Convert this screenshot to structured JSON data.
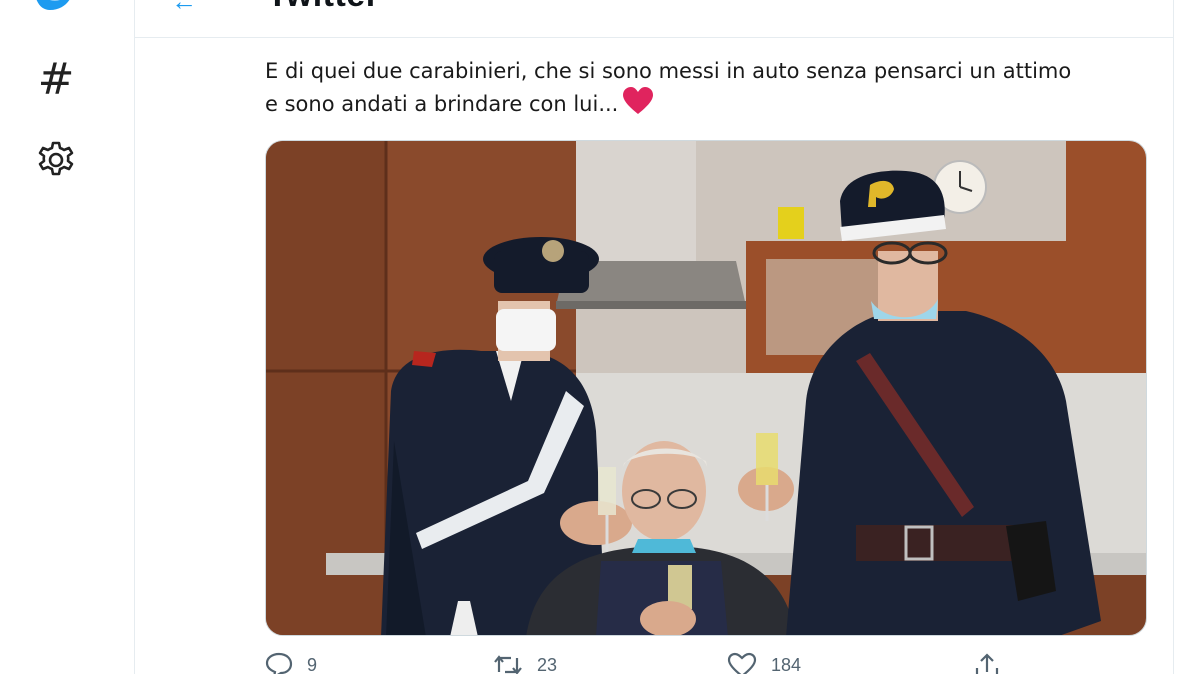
{
  "sidebar": {
    "logo_icon": "twitter-bird-icon",
    "items": [
      {
        "icon": "hashtag-icon",
        "glyph": "#"
      },
      {
        "icon": "gear-icon"
      }
    ]
  },
  "header": {
    "title": "Twitter"
  },
  "tweet": {
    "text_line1": "E di quei due carabinieri, che si sono messi in auto senza pensarci un attimo",
    "text_line2": "e sono andati a brindare con lui...",
    "emoji": "red-heart",
    "actions": [
      {
        "name": "reply",
        "icon": "reply-icon",
        "count": "9"
      },
      {
        "name": "retweet",
        "icon": "retweet-icon",
        "count": "23"
      },
      {
        "name": "like",
        "icon": "heart-outline-icon",
        "count": "184"
      },
      {
        "name": "share",
        "icon": "share-icon",
        "count": ""
      }
    ]
  },
  "colors": {
    "accent": "#1d9bf0",
    "heart": "#e0245e",
    "muted": "#536471"
  }
}
